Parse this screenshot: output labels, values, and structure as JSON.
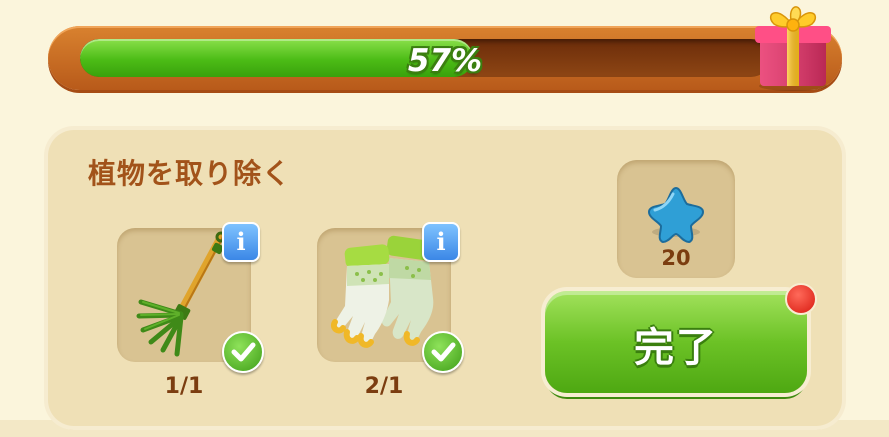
{
  "progress": {
    "percent": 0.57,
    "label": "57%"
  },
  "task": {
    "title": "植物を取り除く",
    "items": [
      {
        "icon": "rake-icon",
        "count": "1/1",
        "completed": true
      },
      {
        "icon": "gloves-icon",
        "count": "2/1",
        "completed": true
      }
    ]
  },
  "reward": {
    "icon": "blue-star-icon",
    "amount": "20"
  },
  "done_button": {
    "label": "完了",
    "has_notification": true
  },
  "colors": {
    "progress_fill": "#4cbc16",
    "accent_orange": "#c8661f",
    "button_green": "#6cc226"
  }
}
